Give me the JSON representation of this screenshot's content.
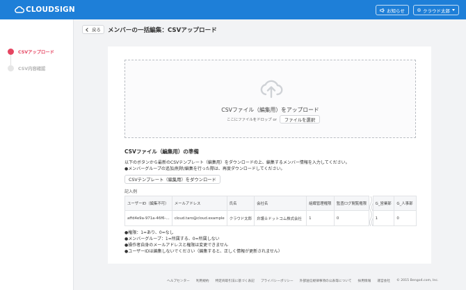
{
  "header": {
    "logo_text": "CLOUDSIGN",
    "notice_label": "お知らせ",
    "user_label": "クラウド太郎"
  },
  "sidebar": {
    "steps": [
      {
        "label": "CSVアップロード",
        "state": "active"
      },
      {
        "label": "CSV内容確認",
        "state": "inactive"
      }
    ]
  },
  "titlebar": {
    "back_label": "戻る",
    "page_title": "メンバーの一括編集：CSVアップロード"
  },
  "dropzone": {
    "title": "CSVファイル（編集用）をアップロード",
    "hint": "ここにファイルをドロップ or",
    "select_label": "ファイルを選択"
  },
  "prep": {
    "title": "CSVファイル（編集用）の準備",
    "desc1": "以下のボタンから最新のCSVテンプレート（編集用）をダウンロードの上、編集するメンバー情報を入力してください。",
    "desc2": "●メンバーグループの追加/削除/編集を行った際は、再度ダウンロードしてください。",
    "download_label": "CSVテンプレート（編集用）をダウンロード",
    "example_label": "記入例"
  },
  "example_table": {
    "headers": [
      "ユーザーID（編集不可）",
      "メールアドレス",
      "氏名",
      "会社名",
      "組織管理権限",
      "監査ログ閲覧権限",
      "",
      "G_営業部",
      "G_人事部"
    ],
    "row": [
      "affd4e9a-971a-46f6-...",
      "cloud.taro@cloud.example",
      "クラウド太郎",
      "弁護士ドットコム株式会社",
      "1",
      "0",
      "",
      "1",
      "0"
    ]
  },
  "notes": [
    "●権限：1=あり、0=なし",
    "●メンバーグループ：1=所属する、0=所属しない",
    "●操作者自身のメールアドレスと権限は変更できません",
    "●ユーザーIDは編集しないでください（編集すると、正しく情報が更新されません）"
  ],
  "footer": {
    "links": [
      "ヘルプセンター",
      "利用規約",
      "特定商取引法に基づく表記",
      "プライバシーポリシー",
      "外部送信規律事項の公表等について",
      "採用情報",
      "運営会社"
    ],
    "copyright": "© 2015 Bengo4.com, Inc."
  },
  "colors": {
    "header_bg": "#1e7fd8",
    "accent": "#e54561"
  }
}
